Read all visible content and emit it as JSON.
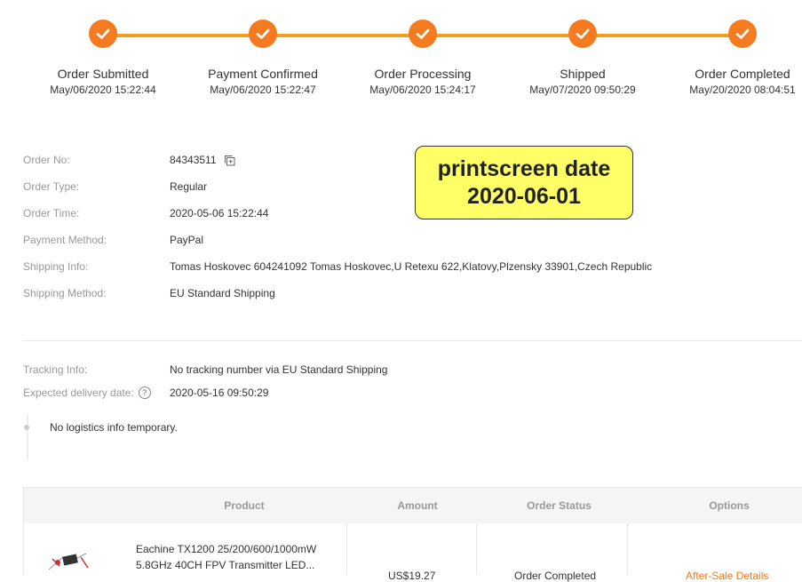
{
  "progress": {
    "steps": [
      {
        "label": "Order Submitted",
        "date": "May/06/2020 15:22:44"
      },
      {
        "label": "Payment Confirmed",
        "date": "May/06/2020 15:22:47"
      },
      {
        "label": "Order Processing",
        "date": "May/06/2020 15:24:17"
      },
      {
        "label": "Shipped",
        "date": "May/07/2020 09:50:29"
      },
      {
        "label": "Order Completed",
        "date": "May/20/2020 08:04:51"
      }
    ],
    "accent_color": "#f47b20",
    "line_color": "#f0a020"
  },
  "order": {
    "order_no_label": "Order No:",
    "order_no": "84343511",
    "order_type_label": "Order Type:",
    "order_type": "Regular",
    "order_time_label": "Order Time:",
    "order_time": "2020-05-06 15:22:44",
    "payment_method_label": "Payment Method:",
    "payment_method": "PayPal",
    "shipping_info_label": "Shipping Info:",
    "shipping_info": "Tomas Hoskovec 604241092 Tomas Hoskovec,U Retexu 622,Klatovy,Plzensky 33901,Czech Republic",
    "shipping_method_label": "Shipping Method:",
    "shipping_method": "EU Standard Shipping"
  },
  "note": {
    "line1": "printscreen date",
    "line2": "2020-06-01",
    "color": "#ffff66"
  },
  "tracking": {
    "tracking_info_label": "Tracking Info:",
    "tracking_info": "No tracking number via EU Standard Shipping",
    "expected_label": "Expected delivery date:",
    "expected": "2020-05-16 09:50:29",
    "help_icon": "question-circle-icon",
    "logistics_text": "No logistics info temporary."
  },
  "table": {
    "headers": {
      "product": "Product",
      "amount": "Amount",
      "status": "Order Status",
      "options": "Options"
    },
    "rows": [
      {
        "product_name": "Eachine TX1200 25/200/600/1000mW 5.8GHz 40CH FPV Transmitter LED...",
        "amount": "US$19.27",
        "status": "Order Completed",
        "option": "After-Sale Details"
      }
    ]
  }
}
